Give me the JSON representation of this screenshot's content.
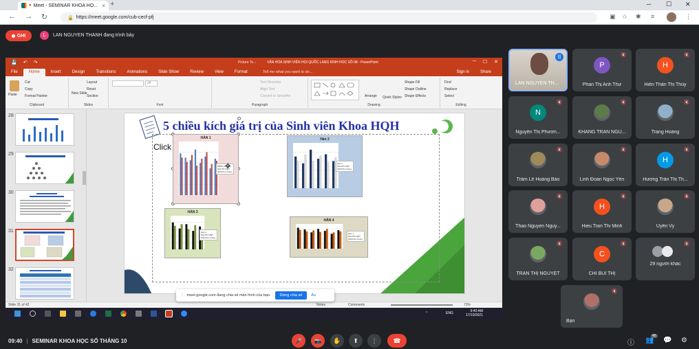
{
  "browser": {
    "tab_title": "Meet - SEMINAR KHOA HỌ...",
    "new_tab": "+",
    "url": "https://meet.google.com/cub-cecf-pfj",
    "lock_icon": "🔒",
    "back_icon": "←",
    "forward_icon": "→",
    "reload_icon": "↻",
    "menu_icon": "⋮",
    "minimize": "─",
    "maximize": "☐",
    "close": "✕",
    "tab_close": "×"
  },
  "meet_header": {
    "record_label": "GHI",
    "presenter_initial": "L",
    "presenter_text": "LAN NGUYEN THANH đang trình bày"
  },
  "ppt": {
    "qat_save": "💾",
    "qat_undo": "↶",
    "qat_redo": "↷",
    "context_tab": "Picture To...",
    "doc_title": "VĂN HÓA SINH VIÊN HỌI QUỐC LANG KINH HOC SỐ 08 - PowerPoint",
    "win_min": "─",
    "win_max": "☐",
    "win_close": "✕",
    "tabs": [
      "File",
      "Home",
      "Insert",
      "Design",
      "Transitions",
      "Animations",
      "Slide Show",
      "Review",
      "View",
      "Format"
    ],
    "tell_me": "Tell me what you want to do...",
    "sign_in": "Sign in",
    "share": "Share",
    "ribbon": {
      "paste": "Paste",
      "cut": "Cut",
      "copy": "Copy",
      "format_painter": "Format Painter",
      "clipboard": "Clipboard",
      "new_slide": "New Slide",
      "layout": "Layout",
      "reset": "Reset",
      "section": "Section",
      "slides": "Slides",
      "font_size": "24",
      "font": "Font",
      "text_direction": "Text Direction",
      "align_text": "Align Text",
      "convert_smartart": "Convert to SmartArt",
      "paragraph": "Paragraph",
      "arrange": "Arrange",
      "quick_styles": "Quick Styles",
      "shape_fill": "Shape Fill",
      "shape_outline": "Shape Outline",
      "shape_effects": "Shape Effects",
      "drawing": "Drawing",
      "find": "Find",
      "replace": "Replace",
      "select": "Select",
      "editing": "Editing"
    },
    "thumb_numbers": [
      "28",
      "29",
      "30",
      "31",
      "32"
    ],
    "slide": {
      "title": "5 chiều kích giá trị của Sinh viên Khoa HQH",
      "click_text": "Click",
      "charts": [
        {
          "title": "HÀN 1",
          "legend": [
            "ĐIỂM CHUẨN",
            "NGƯỜI VIỆT NAM lữu chung"
          ],
          "colors": [
            "#4f7fc0",
            "#c0504d"
          ],
          "values": [
            [
              78,
              70,
              65,
              85,
              60,
              72,
              50,
              68
            ],
            [
              70,
              62,
              75,
              55,
              68,
              80,
              58,
              64
            ]
          ]
        },
        {
          "title": "Hàn 2",
          "legend": [
            "Hàn 1",
            "NGƯỜI VIỆT NAM lữu chung"
          ],
          "colors": [
            "#1f3864",
            "#d9d9d9"
          ],
          "values": [
            [
              70,
              55,
              85,
              65,
              75,
              60
            ],
            [
              60,
              75,
              60,
              72,
              58,
              68
            ]
          ]
        },
        {
          "title": "HÀN 3",
          "legend": [
            "Hàn 1",
            "NGƯỜI VIỆT NAM lữu chung"
          ],
          "colors": [
            "#111111",
            "#77933c"
          ],
          "values": [
            [
              80,
              62,
              75,
              55,
              68
            ],
            [
              70,
              75,
              60,
              72,
              58
            ]
          ]
        },
        {
          "title": "HÀN 4",
          "legend": [
            "Hàn 1",
            "NGƯỜI VIỆT NAM lữu chung"
          ],
          "colors": [
            "#111111",
            "#c55a11"
          ],
          "values": [
            [
              85,
              78,
              66,
              80,
              72,
              60,
              75
            ],
            [
              76,
              70,
              74,
              68,
              80,
              66,
              70
            ]
          ]
        }
      ]
    },
    "status": {
      "slide_of": "Slide 31 of 42",
      "notes": "Notes",
      "comments": "Comments",
      "zoom": "73%"
    },
    "share_notice": {
      "text": "meet.google.com đang chia sẻ màn hình của bạn.",
      "stop": "Dừng chia sẻ",
      "hide": "Ẩn"
    },
    "taskbar": {
      "time": "9:40 AM",
      "date": "17/10/2021",
      "lang": "ENG"
    }
  },
  "participants": [
    {
      "name": "LAN NGUYEN TH...",
      "initial": "",
      "color": "#6d4c41",
      "video": true
    },
    {
      "name": "Phan Thị Anh Thư",
      "initial": "P",
      "color": "#7e57c2"
    },
    {
      "name": "Hiền Thân Thị Thúy",
      "initial": "H",
      "color": "#f4511e"
    },
    {
      "name": "Nguyễn Thị Phươn...",
      "initial": "N",
      "color": "#00897b"
    },
    {
      "name": "KHANG TRAN NGU...",
      "initial": "",
      "color": "#5d7a4a"
    },
    {
      "name": "Trang Hoàng",
      "initial": "",
      "color": "#8fb0c8"
    },
    {
      "name": "Trầm Lê Hoàng Bảo",
      "initial": "",
      "color": "#9e8a5a"
    },
    {
      "name": "Linh Đoàn Ngọc Yến",
      "initial": "",
      "color": "#c48a6a"
    },
    {
      "name": "Hương Trần Thị Th...",
      "initial": "H",
      "color": "#039be5"
    },
    {
      "name": "Thao Nguyen Nguy...",
      "initial": "",
      "color": "#e0a09a"
    },
    {
      "name": "Hieu Tran Thi Minh",
      "initial": "H",
      "color": "#f4511e"
    },
    {
      "name": "Uyên Vy",
      "initial": "",
      "color": "#c7a68a"
    },
    {
      "name": "TRẦN THỊ NGUYỆT",
      "initial": "",
      "color": "#7aa860"
    },
    {
      "name": "CHI BÙI THỊ",
      "initial": "C",
      "color": "#f4511e"
    },
    {
      "name": "29 người khác",
      "initial": "",
      "color": "#9aa0a6"
    },
    {
      "name": "Bạn",
      "initial": "",
      "color": "#b0706a"
    }
  ],
  "bottom": {
    "time": "09:40",
    "separator": "|",
    "meeting_title": "SEMINAR KHOA HỌC SỐ THÁNG 10",
    "mic_icon": "🎤",
    "cam_icon": "📷",
    "hand_icon": "✋",
    "present_icon": "⬆",
    "more_icon": "⋮",
    "hangup_icon": "☎",
    "info_icon": "ⓘ",
    "people_count": "45",
    "people_icon": "👥",
    "chat_icon": "💬",
    "activities_icon": "⚙"
  }
}
